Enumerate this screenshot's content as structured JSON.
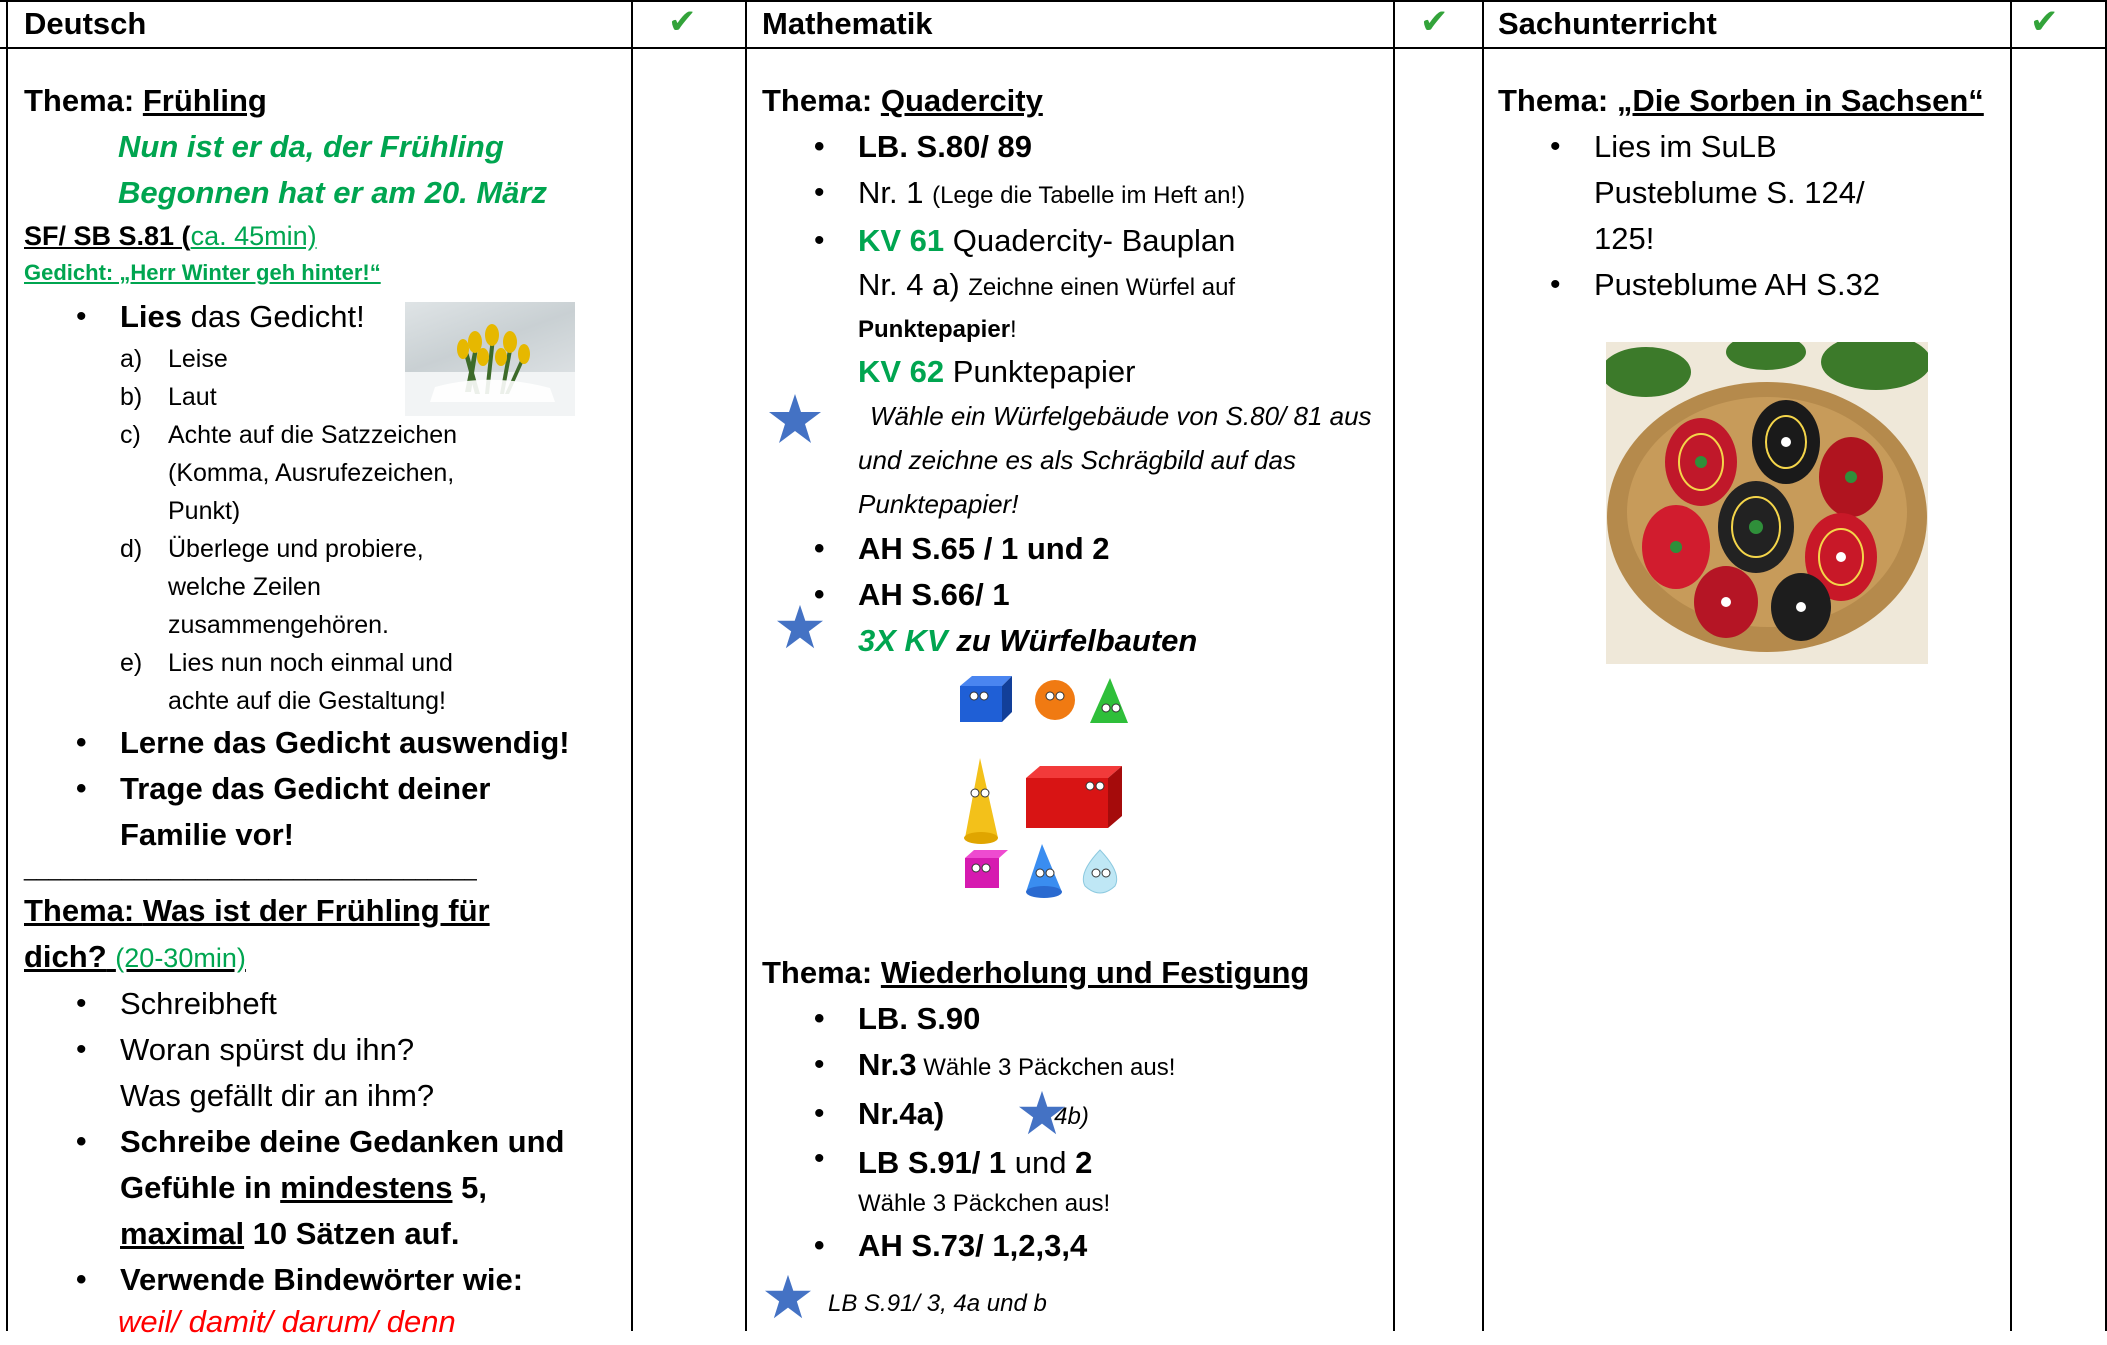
{
  "header": {
    "deutsch": "Deutsch",
    "mathe": "Mathematik",
    "sach": "Sachunterricht",
    "check": "✔"
  },
  "deutsch": {
    "thema1_prefix": "Thema: ",
    "thema1": "Frühling",
    "line1": "Nun ist er da, der Frühling",
    "line2": "Begonnen hat er am 20. März",
    "sf_label": "SF/ SB S.81 (",
    "sf_time": "ca.  45min)",
    "gedicht": "Gedicht: „Herr Winter geh hinter!“",
    "lies_bold": "Lies",
    "lies_rest": " das Gedicht!",
    "sub": [
      "Leise",
      "Laut",
      "Achte auf die Satzzeichen (Komma, Ausrufezeichen, Punkt)",
      "Überlege und probiere, welche Zeilen zusammengehören.",
      "Lies nun noch einmal und achte auf die Gestaltung!"
    ],
    "sub_labels": [
      "a)",
      "b)",
      "c)",
      "d)",
      "e)"
    ],
    "lerne": "Lerne das Gedicht auswendig!",
    "trage": "Trage das Gedicht deiner Familie vor!",
    "divider": "_____________________________________",
    "thema2_prefix": "Thema: ",
    "thema2": "Was ist der Frühling für dich?",
    "thema2_time": "(20-30min)",
    "schreibheft": "Schreibheft",
    "woran": "Woran spürst du ihn? Was gefällt dir an ihm?",
    "schreibe_a": "Schreibe deine Gedanken und Gefühle in ",
    "schreibe_b": "mindestens",
    "schreibe_c": " 5, ",
    "schreibe_d": "maximal",
    "schreibe_e": " 10 Sätzen auf.",
    "verwende": "Verwende Bindewörter wie:",
    "bindewoerter": "weil/ damit/ darum/ denn"
  },
  "mathe": {
    "thema1_prefix": "Thema: ",
    "thema1": "Quadercity",
    "lb1": "LB. S.80/ 89",
    "nr1_a": "Nr. 1 ",
    "nr1_b": "(Lege die Tabelle im Heft an!)",
    "kv61": "KV 61",
    "kv61_rest": " Quadercity- Bauplan",
    "nr4_a": "Nr. 4 a) ",
    "nr4_b": "Zeichne einen Würfel auf ",
    "nr4_c": "Punktepapier",
    "nr4_d": "!",
    "kv62": "KV 62",
    "kv62_rest": " Punktepapier",
    "waehle": "Wähle ein Würfelgebäude von S.80/ 81 aus und zeichne es als Schrägbild auf das Punktepapier!",
    "ah65": "AH S.65 / 1 und 2",
    "ah66": "AH S.66/ 1",
    "kv3x": "3X KV",
    "kv3x_rest": " zu Würfelbauten",
    "thema2_prefix": "Thema: ",
    "thema2": "Wiederholung und Festigung",
    "lb90": "LB. S.90",
    "nr3_a": "Nr.3",
    "nr3_b": " Wähle 3 Päckchen aus!",
    "nr4a": "Nr.4a)",
    "nr4b": "4b)",
    "lb91_a": "LB S.91/ 1",
    "lb91_b": " und ",
    "lb91_c": "2",
    "lb91_sub": "Wähle 3 Päckchen aus!",
    "ah73": "AH S.73/ 1,2,3,4",
    "lb91_star": "LB S.91/ 3, 4a und b"
  },
  "sach": {
    "thema_prefix": "Thema: ",
    "thema": "„Die Sorben in Sachsen“",
    "lies": "Lies im SuLB Pusteblume S. 124/ 125!",
    "ah": "Pusteblume AH S.32"
  },
  "colors": {
    "green": "#00a550",
    "red": "#ff0000",
    "star": "#4472c4",
    "check": "#33a33a"
  }
}
